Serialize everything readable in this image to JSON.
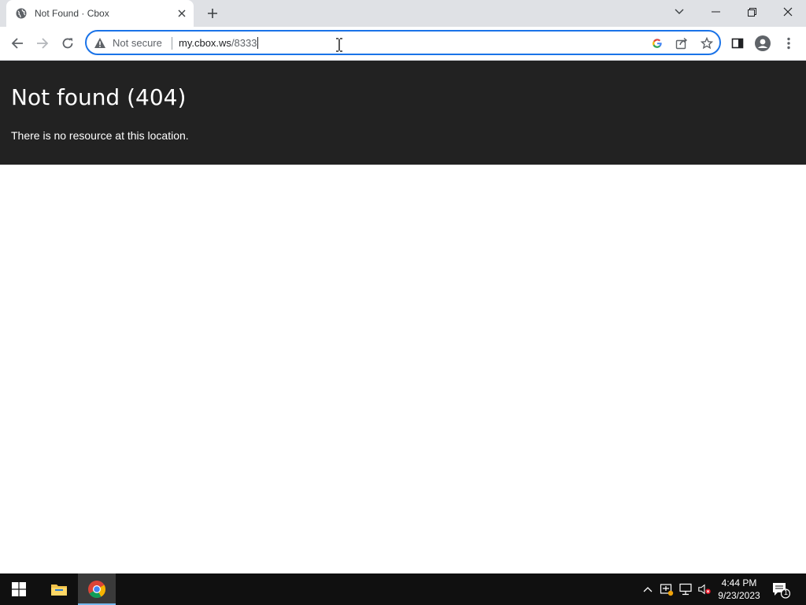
{
  "browser": {
    "tab": {
      "title": "Not Found · Cbox",
      "favicon": "globe-icon"
    },
    "omnibox": {
      "security_label": "Not secure",
      "url_host": "my.cbox.ws",
      "url_path": "/8333"
    },
    "accent_color": "#1a73e8"
  },
  "page": {
    "heading": "Not found (404)",
    "message": "There is no resource at this location.",
    "banner_color": "#222222"
  },
  "taskbar": {
    "apps": [
      "windows-start",
      "file-explorer",
      "google-chrome"
    ],
    "clock": {
      "time": "4:44 PM",
      "date": "9/23/2023"
    },
    "notification_count": "1"
  }
}
